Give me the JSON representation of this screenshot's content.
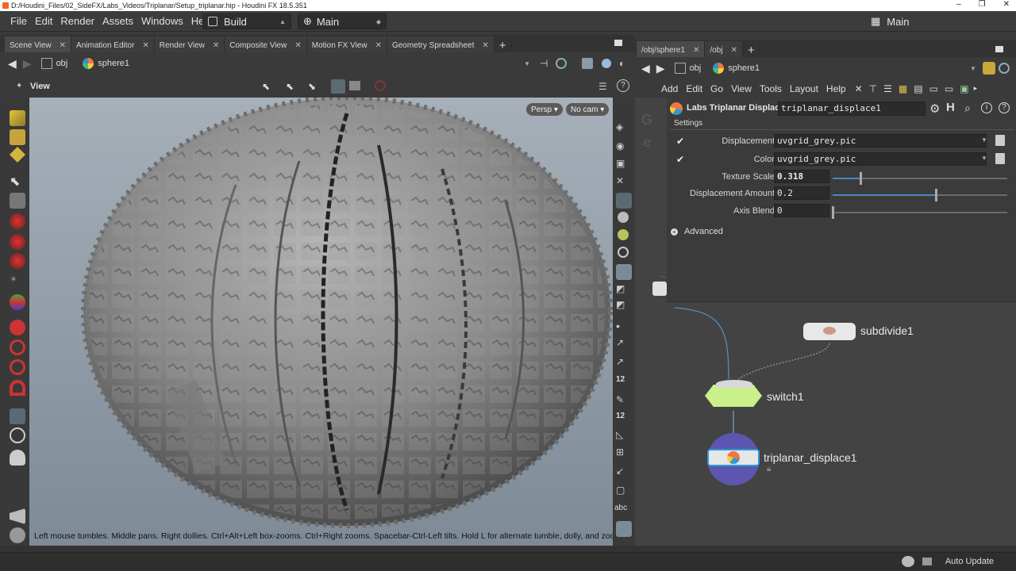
{
  "window": {
    "title": "D:/Houdini_Files/02_SideFX/Labs_Videos/Triplanar/Setup_triplanar.hip - Houdini FX 18.5.351",
    "controls": [
      "–",
      "❐",
      "✕"
    ]
  },
  "menubar": {
    "items": [
      "File",
      "Edit",
      "Render",
      "Assets",
      "Windows",
      "Help"
    ],
    "desktop": "Build",
    "desktop_right": "Main",
    "desktop_far_right": "Main"
  },
  "left_tabs": [
    {
      "label": "Scene View",
      "active": true
    },
    {
      "label": "Animation Editor"
    },
    {
      "label": "Render View"
    },
    {
      "label": "Composite View"
    },
    {
      "label": "Motion FX View"
    },
    {
      "label": "Geometry Spreadsheet"
    }
  ],
  "right_tabs": [
    {
      "label": "/obj/sphere1",
      "active": true
    },
    {
      "label": "/obj"
    }
  ],
  "left_path": {
    "root": "obj",
    "node": "sphere1"
  },
  "right_path": {
    "root": "obj",
    "node": "sphere1"
  },
  "view": {
    "label": "View",
    "persp": "Persp",
    "cam": "No cam",
    "hint": "Left mouse tumbles. Middle pans. Right dollies. Ctrl+Alt+Left box-zooms. Ctrl+Right zooms. Spacebar-Ctrl-Left tilts. Hold L for alternate tumble, dolly, and zoom."
  },
  "net_menu": [
    "Add",
    "Edit",
    "Go",
    "View",
    "Tools",
    "Layout",
    "Help"
  ],
  "params": {
    "node_type": "Labs Triplanar Displace",
    "node_name": "triplanar_displace1",
    "folder": "Settings",
    "rows": [
      {
        "label": "Displacement",
        "value": "uvgrid_grey.pic",
        "kind": "file"
      },
      {
        "label": "Color",
        "value": "uvgrid_grey.pic",
        "kind": "file"
      },
      {
        "label": "Texture Scale",
        "value": "0.318",
        "kind": "slider",
        "fraction": 0.16
      },
      {
        "label": "Displacement Amount",
        "value": "0.2",
        "kind": "slider",
        "fraction": 0.59
      },
      {
        "label": "Axis Blend",
        "value": "0",
        "kind": "slider",
        "fraction": 0.0
      }
    ],
    "advanced": "Advanced"
  },
  "nodes": {
    "subdivide": "subdivide1",
    "switch": "switch1",
    "triplanar": "triplanar_displace1"
  },
  "status": {
    "auto_update": "Auto Update"
  },
  "shelf_right_labels": {
    "twelve_a": "12",
    "twelve_b": "12",
    "abc": "abc"
  },
  "colors": {
    "accent": "#4a86c5",
    "switch_node": "#c9f08a",
    "triplanar_ring": "#5d56b0",
    "orange": "#f0a020"
  }
}
